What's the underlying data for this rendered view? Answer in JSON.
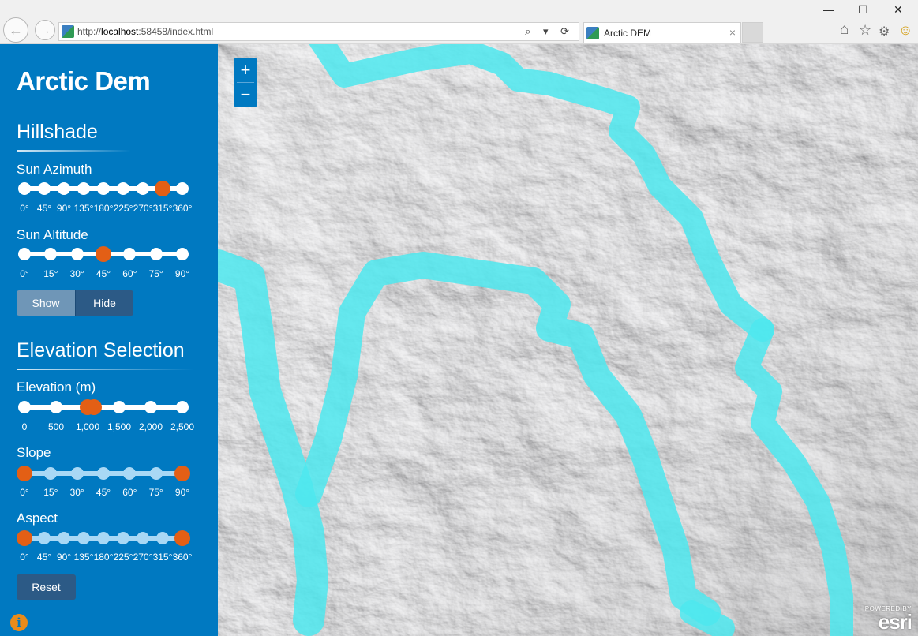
{
  "browser": {
    "url_prefix": "http://",
    "url_host": "localhost",
    "url_rest": ":58458/index.html",
    "tab_title": "Arctic DEM",
    "tab_close": "×",
    "back_glyph": "←",
    "forward_glyph": "→",
    "addr_tools": "⌕ ▾ ⟳",
    "minimize": "—",
    "maximize": "☐",
    "close": "✕",
    "home_icon": "⌂",
    "star_icon": "☆",
    "gear_icon": "⚙",
    "smiley_icon": "☺"
  },
  "sidebar": {
    "app_title": "Arctic Dem",
    "hillshade": {
      "title": "Hillshade",
      "azimuth": {
        "label": "Sun Azimuth",
        "ticks": [
          "0°",
          "45°",
          "90°",
          "135°",
          "180°",
          "225°",
          "270°",
          "315°",
          "360°"
        ],
        "value_index": 7,
        "value": "315°"
      },
      "altitude": {
        "label": "Sun Altitude",
        "ticks": [
          "0°",
          "15°",
          "30°",
          "45°",
          "60°",
          "75°",
          "90°"
        ],
        "value_index": 3,
        "value": "45°"
      },
      "show_label": "Show",
      "hide_label": "Hide"
    },
    "elevation": {
      "title": "Elevation Selection",
      "elev": {
        "label": "Elevation (m)",
        "ticks": [
          "0",
          "500",
          "1,000",
          "1,500",
          "2,000",
          "2,500"
        ],
        "range": [
          1000,
          1100
        ],
        "max": 2500
      },
      "slope": {
        "label": "Slope",
        "ticks": [
          "0°",
          "15°",
          "30°",
          "45°",
          "60°",
          "75°",
          "90°"
        ],
        "range": [
          0,
          90
        ]
      },
      "aspect": {
        "label": "Aspect",
        "ticks": [
          "0°",
          "45°",
          "90°",
          "135°",
          "180°",
          "225°",
          "270°",
          "315°",
          "360°"
        ],
        "range": [
          0,
          360
        ]
      },
      "reset_label": "Reset"
    },
    "info_icon": "i"
  },
  "map": {
    "zoom_in": "+",
    "zoom_out": "−",
    "attribution_small": "POWERED BY",
    "attribution_logo": "esri"
  },
  "colors": {
    "sidebar": "#0079c1",
    "handle": "#e35f15",
    "highlight": "#4ee8ee"
  }
}
